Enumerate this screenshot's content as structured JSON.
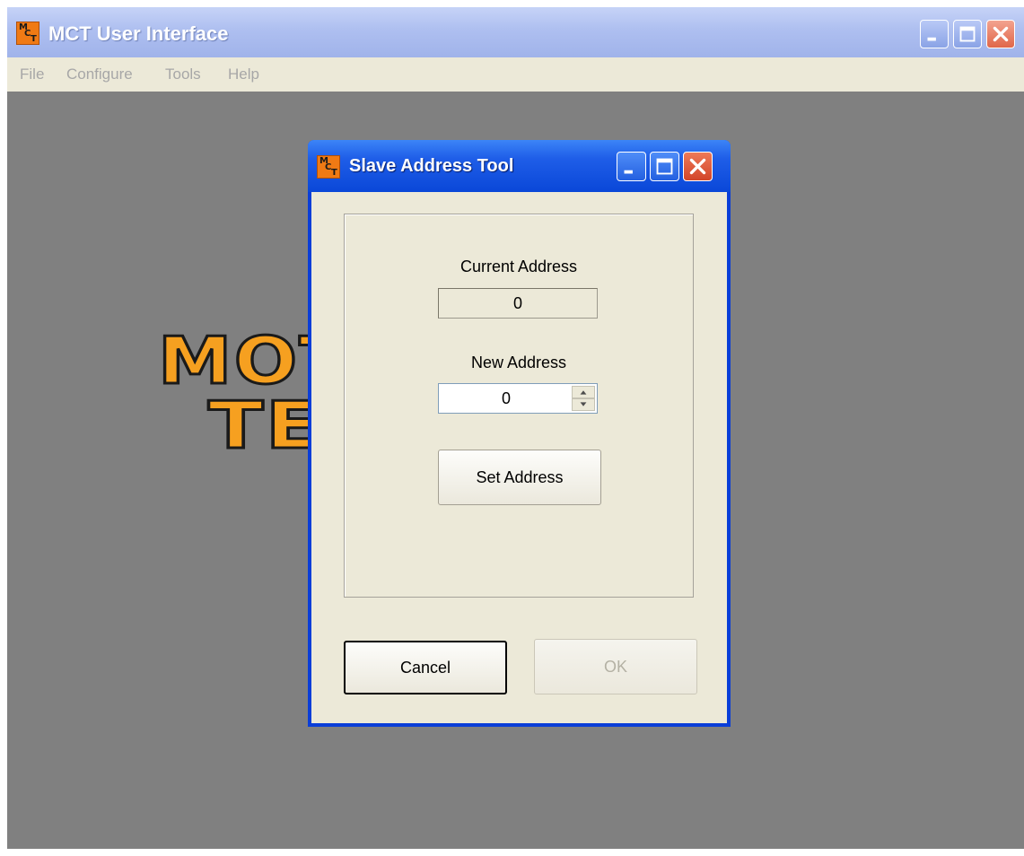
{
  "main_window": {
    "title": "MCT User Interface",
    "menu": [
      "File",
      "Configure",
      "Tools",
      "Help"
    ],
    "logo": {
      "line1": "MOT         ROL",
      "line2": "TE           ES"
    }
  },
  "dialog": {
    "title": "Slave Address Tool",
    "current_address_label": "Current Address",
    "current_address_value": "0",
    "new_address_label": "New Address",
    "new_address_value": "0",
    "set_address_button": "Set Address",
    "cancel_button": "Cancel",
    "ok_button": "OK",
    "ok_enabled": false
  },
  "icons": {
    "app": "mct-app-icon",
    "minimize": "minimize-icon",
    "maximize": "maximize-icon",
    "close": "close-icon",
    "spin_up": "chevron-up-icon",
    "spin_down": "chevron-down-icon"
  },
  "colors": {
    "xp_blue": "#0a47d8",
    "logo_orange": "#f6a020",
    "dialog_face": "#ece9d8",
    "desktop_gray": "#808080"
  }
}
